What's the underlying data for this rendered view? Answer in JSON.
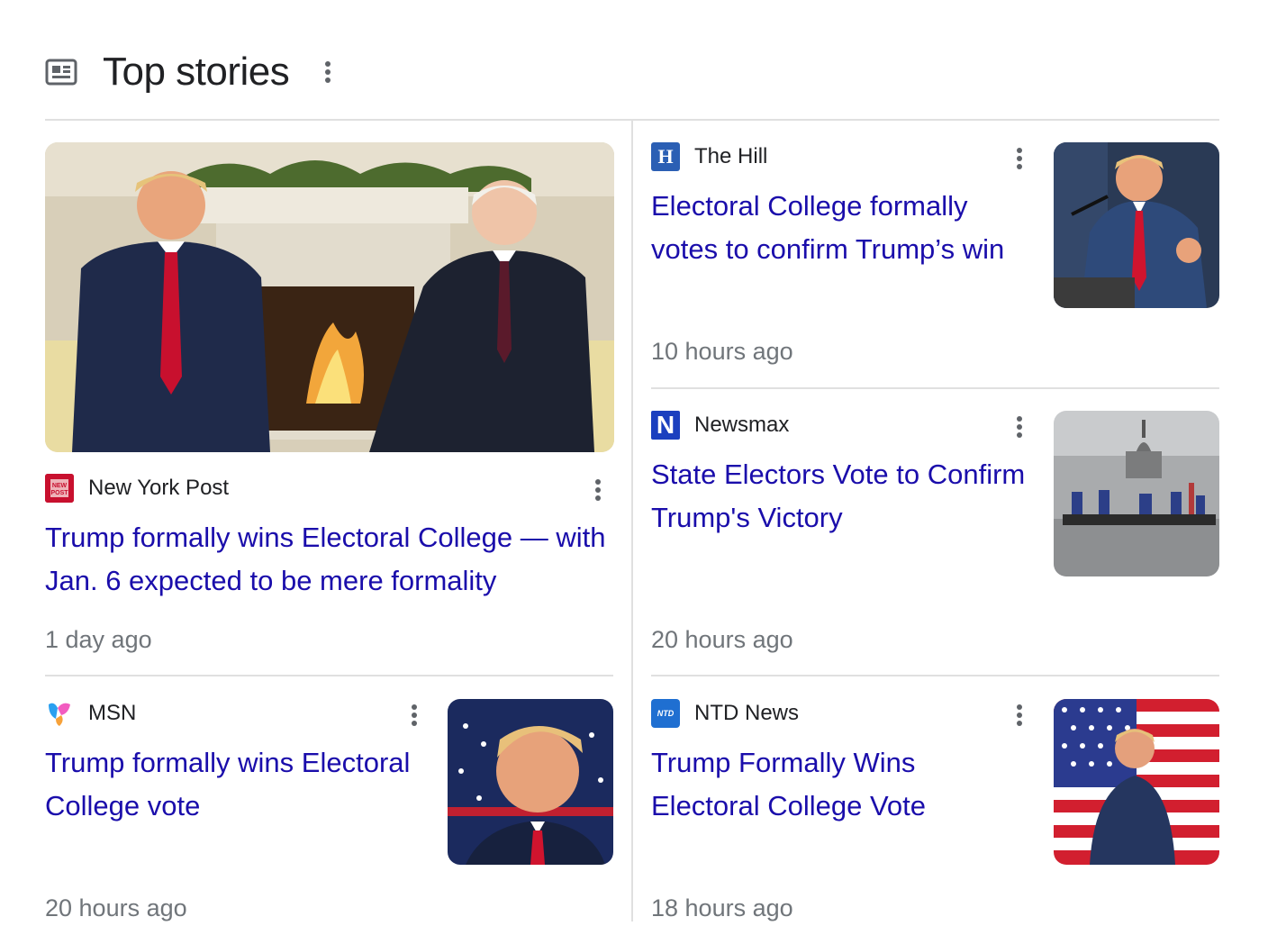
{
  "header": {
    "title": "Top stories"
  },
  "stories": [
    {
      "source": "New York Post",
      "logo_icon": "new-york-post-logo-icon",
      "headline": "Trump formally wins Electoral College — with Jan. 6 expected to be mere formality",
      "time": "1 day ago",
      "thumbnail_icon": "oval-office-fireplace-photo"
    },
    {
      "source": "The Hill",
      "logo_icon": "the-hill-logo-icon",
      "logo_text": "H",
      "headline": "Electoral College formally votes to confirm Trump’s win",
      "time": "10 hours ago",
      "thumbnail_icon": "trump-podium-photo"
    },
    {
      "source": "Newsmax",
      "logo_icon": "newsmax-logo-icon",
      "logo_text": "N",
      "headline": "State Electors Vote to Confirm Trump's Victory",
      "time": "20 hours ago",
      "thumbnail_icon": "capitol-protest-photo"
    },
    {
      "source": "MSN",
      "logo_icon": "msn-logo-icon",
      "headline": "Trump formally wins Electoral College vote",
      "time": "20 hours ago",
      "thumbnail_icon": "trump-flag-smile-photo"
    },
    {
      "source": "NTD News",
      "logo_icon": "ntd-news-logo-icon",
      "logo_text": "NTD",
      "headline": "Trump Formally Wins Electoral College Vote",
      "time": "18 hours ago",
      "thumbnail_icon": "trump-american-flag-photo"
    }
  ],
  "colors": {
    "link": "#1a0dab",
    "text": "#202124",
    "meta": "#70757a",
    "divider": "#e0e0e0"
  }
}
